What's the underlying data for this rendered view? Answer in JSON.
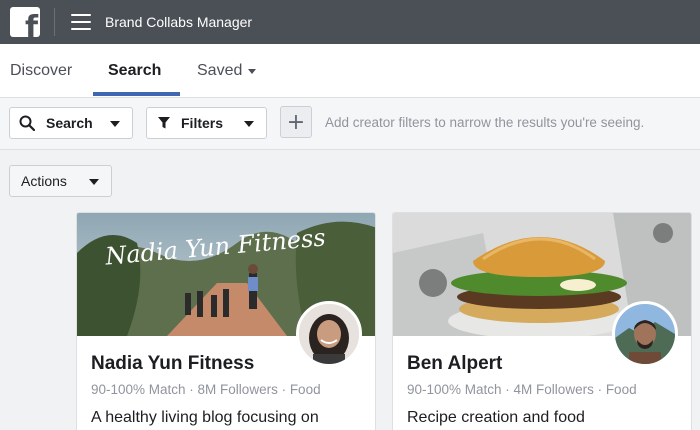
{
  "header": {
    "logo_letter": "f",
    "title": "Brand Collabs Manager"
  },
  "tabs": [
    {
      "label": "Discover",
      "active": false
    },
    {
      "label": "Search",
      "active": true
    },
    {
      "label": "Saved",
      "active": false,
      "has_dropdown": true
    }
  ],
  "toolbar": {
    "search_label": "Search",
    "filters_label": "Filters",
    "add_filter_symbol": "+",
    "hint": "Add creator filters to narrow the results you're seeing.",
    "actions_label": "Actions"
  },
  "cards": [
    {
      "name": "Nadia Yun Fitness",
      "cover_text": "Nadia Yun Fitness",
      "meta": "90-100% Match · 8M Followers · Food",
      "description": "A healthy living blog focusing on"
    },
    {
      "name": "Ben Alpert",
      "meta": "90-100% Match · 4M Followers · Food",
      "description": "Recipe creation and food"
    }
  ],
  "colors": {
    "topbar": "#4b4f56",
    "accent": "#4267b2"
  }
}
